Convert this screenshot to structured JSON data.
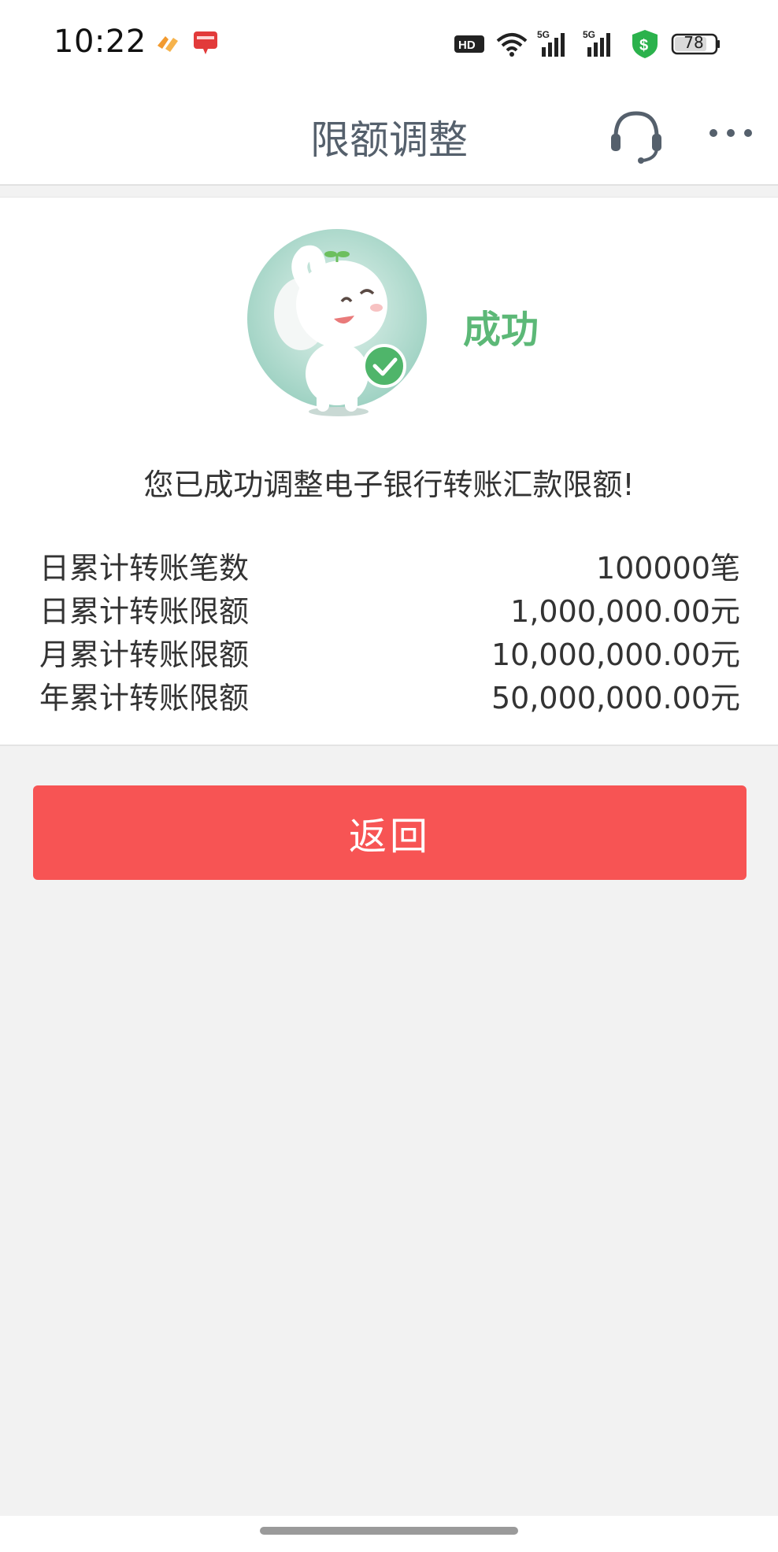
{
  "status_bar": {
    "time": "10:22",
    "battery": "78",
    "icons": [
      "app-icon-orange",
      "app-icon-red",
      "hd-voice-icon",
      "wifi-icon",
      "signal-5g-icon",
      "signal-5g-icon",
      "security-shield-icon",
      "battery-icon"
    ]
  },
  "nav": {
    "title": "限额调整",
    "icons": [
      "headset-icon",
      "more-icon"
    ]
  },
  "result": {
    "status": "成功",
    "message": "您已成功调整电子银行转账汇款限额!",
    "rows": [
      {
        "label": "日累计转账笔数",
        "value": "100000笔"
      },
      {
        "label": "日累计转账限额",
        "value": "1,000,000.00元"
      },
      {
        "label": "月累计转账限额",
        "value": "10,000,000.00元"
      },
      {
        "label": "年累计转账限额",
        "value": "50,000,000.00元"
      }
    ]
  },
  "actions": {
    "return_label": "返回"
  },
  "colors": {
    "accent_button": "#f75454",
    "success_green": "#5cb877",
    "title_gray": "#55606c",
    "background": "#f2f2f2"
  }
}
